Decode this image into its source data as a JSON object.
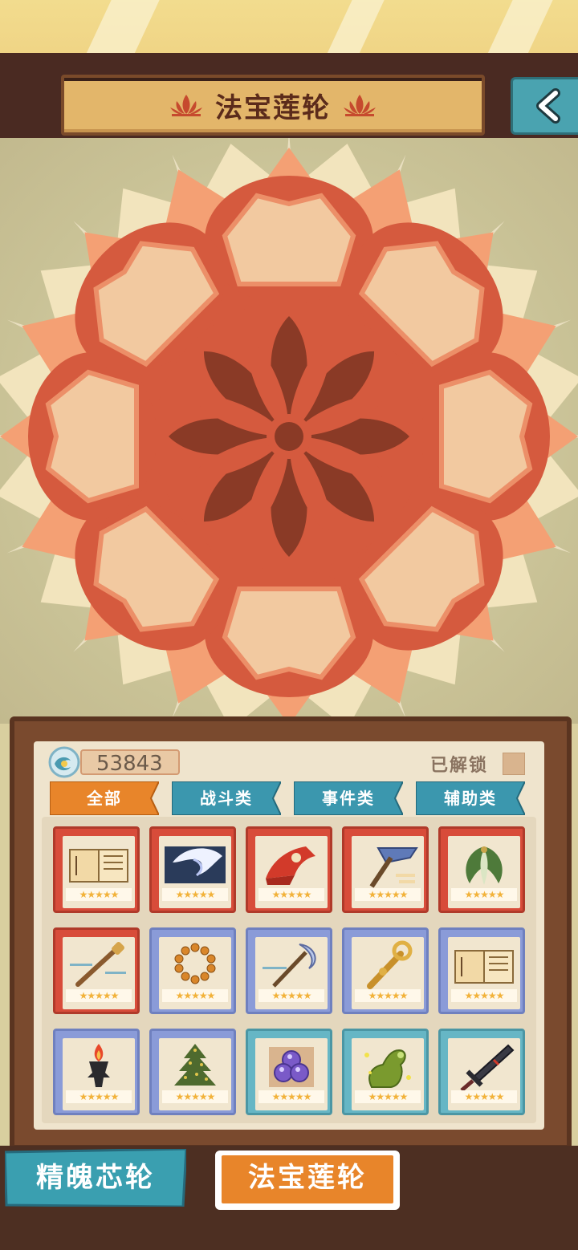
{
  "header": {
    "title": "法宝莲轮"
  },
  "wallet": {
    "amount": "53843"
  },
  "filter": {
    "unlocked_label": "已解锁"
  },
  "tabs": [
    {
      "label": "全部",
      "active": true
    },
    {
      "label": "战斗类",
      "active": false
    },
    {
      "label": "事件类",
      "active": false
    },
    {
      "label": "辅助类",
      "active": false
    }
  ],
  "items": [
    {
      "icon": "scroll-book-icon",
      "rarity": "red",
      "stars": "★★★★★"
    },
    {
      "icon": "feather-quill-icon",
      "rarity": "red",
      "stars": "★★★★★"
    },
    {
      "icon": "red-flag-icon",
      "rarity": "red",
      "stars": "★★★★★"
    },
    {
      "icon": "fan-axe-icon",
      "rarity": "red",
      "stars": "★★★★★"
    },
    {
      "icon": "jade-leaf-icon",
      "rarity": "red",
      "stars": "★★★★★"
    },
    {
      "icon": "wooden-staff-icon",
      "rarity": "red",
      "stars": "★★★★★"
    },
    {
      "icon": "prayer-beads-icon",
      "rarity": "blue",
      "stars": "★★★★★"
    },
    {
      "icon": "moon-spear-icon",
      "rarity": "blue",
      "stars": "★★★★★"
    },
    {
      "icon": "golden-scepter-icon",
      "rarity": "blue",
      "stars": "★★★★★"
    },
    {
      "icon": "open-book-icon",
      "rarity": "blue",
      "stars": "★★★★★"
    },
    {
      "icon": "fire-torch-icon",
      "rarity": "blue",
      "stars": "★★★★★"
    },
    {
      "icon": "pine-tree-icon",
      "rarity": "blue",
      "stars": "★★★★★"
    },
    {
      "icon": "purple-orbs-icon",
      "rarity": "teal",
      "stars": "★★★★★"
    },
    {
      "icon": "green-gourd-icon",
      "rarity": "teal",
      "stars": "★★★★★"
    },
    {
      "icon": "dark-sword-icon",
      "rarity": "teal",
      "stars": "★★★★★"
    }
  ],
  "bottom_nav": {
    "left_label": "精魄芯轮",
    "right_label": "法宝莲轮"
  },
  "colors": {
    "header": "#4a2a22",
    "lotus": "#d55a3e",
    "active_tab": "#e8852a",
    "tab": "#3b97ae"
  }
}
